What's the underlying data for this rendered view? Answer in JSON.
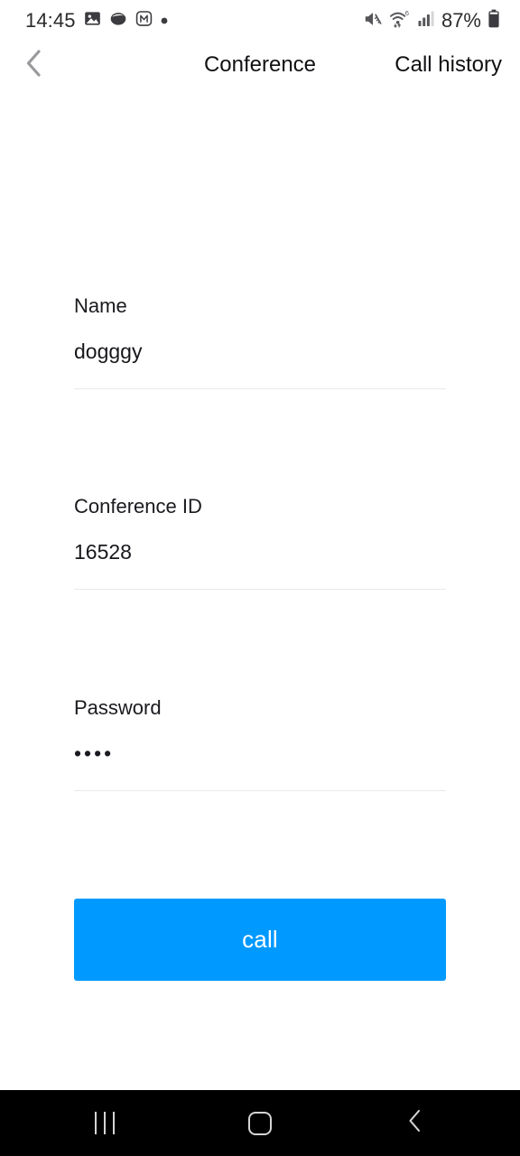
{
  "status_bar": {
    "time": "14:45",
    "battery_percent": "87%",
    "left_icons": [
      "photos-icon",
      "opera-icon",
      "m-app-icon",
      "dot-indicator-icon"
    ],
    "right_icons": [
      "mute-vibrate-icon",
      "wifi-6-icon",
      "cellular-signal-icon",
      "battery-icon"
    ],
    "wifi_generation": "6",
    "text_color": "#2b2b2e"
  },
  "header": {
    "back_icon": "chevron-left-icon",
    "title": "Conference",
    "call_history_label": "Call history",
    "title_color": "#111114",
    "back_icon_color": "#9a9a9e"
  },
  "form": {
    "fields": [
      {
        "label": "Name",
        "value": "dogggy",
        "masked": false,
        "placeholder": "Name"
      },
      {
        "label": "Conference ID",
        "value": "16528",
        "masked": false,
        "placeholder": "Conference ID"
      },
      {
        "label": "Password",
        "value": "••••",
        "masked": true,
        "placeholder": "Password"
      }
    ],
    "underline_color": "#e8e9ec"
  },
  "primary_action": {
    "label": "call",
    "background_color": "#0099ff",
    "text_color": "#ffffff"
  },
  "nav_bar": {
    "background_color": "#000000",
    "icon_color": "#d4d4d4",
    "buttons": [
      {
        "name": "recents-button",
        "icon": "recents-icon"
      },
      {
        "name": "home-button",
        "icon": "home-icon"
      },
      {
        "name": "back-button",
        "icon": "chevron-left-icon"
      }
    ]
  }
}
